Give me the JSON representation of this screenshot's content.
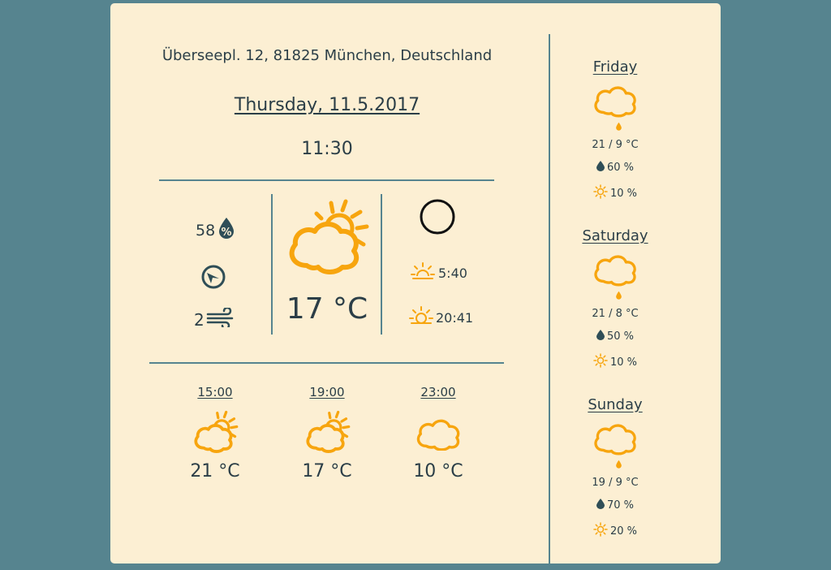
{
  "location": {
    "address": "Überseepl. 12, 81825 München, Deutschland"
  },
  "datetime": {
    "date": "Thursday, 11.5.2017",
    "time": "11:30"
  },
  "current": {
    "humidity": "58",
    "humidity_icon": "humidity-percent-icon",
    "wind_speed": "2",
    "wind_icon": "wind-icon",
    "wind_direction_icon": "compass-icon",
    "condition_icon": "partly-cloudy-icon",
    "temperature": "17 °C",
    "moon_icon": "moon-phase-icon",
    "sunrise": "5:40",
    "sunset": "20:41"
  },
  "hourly": [
    {
      "time": "15:00",
      "icon": "partly-cloudy-icon",
      "temp": "21 °C"
    },
    {
      "time": "19:00",
      "icon": "partly-cloudy-icon",
      "temp": "17 °C"
    },
    {
      "time": "23:00",
      "icon": "cloudy-icon",
      "temp": "10 °C"
    }
  ],
  "daily": [
    {
      "day": "Friday",
      "icon": "light-rain-icon",
      "range": "21 / 9 °C",
      "precip": "60 %",
      "sun": "10 %"
    },
    {
      "day": "Saturday",
      "icon": "light-rain-icon",
      "range": "21 / 8 °C",
      "precip": "50 %",
      "sun": "10 %"
    },
    {
      "day": "Sunday",
      "icon": "light-rain-icon",
      "range": "19 / 9 °C",
      "precip": "70 %",
      "sun": "20 %"
    }
  ],
  "colors": {
    "background": "#56848f",
    "card": "#fcefd3",
    "accent": "#f7a50e",
    "text": "#2b3e47"
  }
}
